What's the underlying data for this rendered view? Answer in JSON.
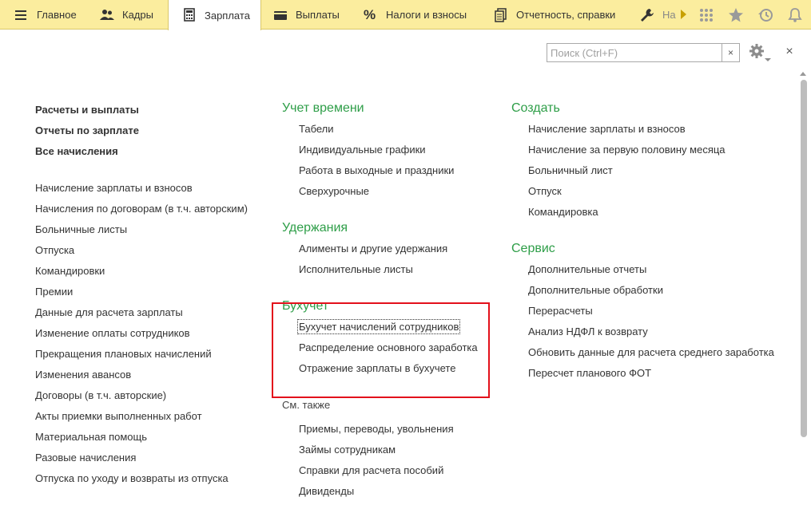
{
  "tabs": [
    {
      "label": "Главное",
      "icon": "menu-icon"
    },
    {
      "label": "Кадры",
      "icon": "people-icon"
    },
    {
      "label": "Зарплата",
      "icon": "calculator-icon"
    },
    {
      "label": "Выплаты",
      "icon": "wallet-icon"
    },
    {
      "label": "Налоги и взносы",
      "icon": "percent-icon"
    },
    {
      "label": "Отчетность, справки",
      "icon": "documents-icon"
    },
    {
      "label": "На",
      "icon": "wrench-icon"
    }
  ],
  "active_tab": "Зарплата",
  "top_icons": [
    "grid-icon",
    "star-icon",
    "history-icon",
    "bell-icon"
  ],
  "search": {
    "placeholder": "Поиск (Ctrl+F)",
    "value": "",
    "clear": "×"
  },
  "close_label": "×",
  "column1": {
    "main_links": [
      "Расчеты и выплаты",
      "Отчеты по зарплате",
      "Все начисления"
    ],
    "links": [
      "Начисление зарплаты и взносов",
      "Начисления по договорам (в т.ч. авторским)",
      "Больничные листы",
      "Отпуска",
      "Командировки",
      "Премии",
      "Данные для расчета зарплаты",
      "Изменение оплаты сотрудников",
      "Прекращения плановых начислений",
      "Изменения авансов",
      "Договоры (в т.ч. авторские)",
      "Акты приемки выполненных работ",
      "Материальная помощь",
      "Разовые начисления",
      "Отпуска по уходу и возвраты из отпуска"
    ]
  },
  "column2": {
    "sections": [
      {
        "title": "Учет времени",
        "items": [
          "Табели",
          "Индивидуальные графики",
          "Работа в выходные и праздники",
          "Сверхурочные"
        ]
      },
      {
        "title": "Удержания",
        "items": [
          "Алименты и другие удержания",
          "Исполнительные листы"
        ]
      },
      {
        "title": "Бухучет",
        "items": [
          "Бухучет начислений сотрудников",
          "Распределение основного заработка",
          "Отражение зарплаты в бухучете"
        ]
      }
    ],
    "see_also_title": "См. также",
    "see_also": [
      "Приемы, переводы, увольнения",
      "Займы сотрудникам",
      "Справки для расчета пособий",
      "Дивиденды"
    ]
  },
  "column3": {
    "sections": [
      {
        "title": "Создать",
        "items": [
          "Начисление зарплаты и взносов",
          "Начисление за первую половину месяца",
          "Больничный лист",
          "Отпуск",
          "Командировка"
        ]
      },
      {
        "title": "Сервис",
        "items": [
          "Дополнительные отчеты",
          "Дополнительные обработки",
          "Перерасчеты",
          "Анализ НДФЛ к возврату",
          "Обновить данные для расчета среднего заработка",
          "Пересчет планового ФОТ"
        ]
      }
    ]
  },
  "colors": {
    "tabbar_bg": "#fbed9e",
    "section_title": "#2e9e48",
    "highlight_border": "#e3101b"
  }
}
